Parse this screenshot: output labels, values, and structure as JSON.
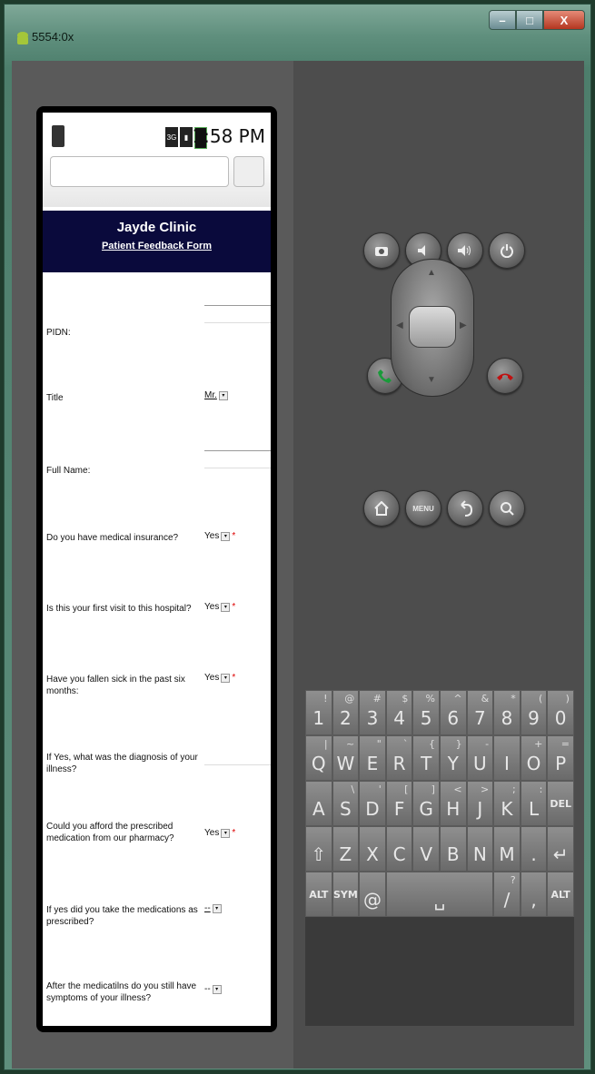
{
  "window": {
    "title": "5554:0x"
  },
  "phone": {
    "time": "1:58 PM",
    "network": "3G"
  },
  "page": {
    "clinic_name": "Jayde Clinic",
    "form_title": "Patient Feedback Form",
    "fields": [
      {
        "label": "PIDN:",
        "type": "text"
      },
      {
        "label": "Title",
        "type": "select",
        "value": "Mr."
      },
      {
        "label": "Full Name:",
        "type": "text"
      },
      {
        "label": "Do you have medical insurance?",
        "type": "select",
        "value": "Yes",
        "required": true
      },
      {
        "label": "Is this your first visit to this hospital?",
        "type": "select",
        "value": "Yes",
        "required": true
      },
      {
        "label": "Have you fallen sick in the past six months:",
        "type": "select",
        "value": "Yes",
        "required": true
      },
      {
        "label": "If Yes, what was the diagnosis of your illness?",
        "type": "text"
      },
      {
        "label": "Could you afford the prescribed medication from our pharmacy?",
        "type": "select",
        "value": "Yes",
        "required": true
      },
      {
        "label": "If yes did you take the medications as prescribed?",
        "type": "select",
        "value": "--"
      },
      {
        "label": "After the medicatilns do you still have symptoms of your illness?",
        "type": "select",
        "value": "--"
      }
    ],
    "required_mark": "*"
  },
  "hardware_buttons": {
    "menu_label": "MENU"
  },
  "keyboard": {
    "row1": [
      [
        "1",
        "!"
      ],
      [
        "2",
        "@"
      ],
      [
        "3",
        "#"
      ],
      [
        "4",
        "$"
      ],
      [
        "5",
        "%"
      ],
      [
        "6",
        "^"
      ],
      [
        "7",
        "&"
      ],
      [
        "8",
        "*"
      ],
      [
        "9",
        "("
      ],
      [
        "0",
        ")"
      ]
    ],
    "row2": [
      [
        "Q",
        "|"
      ],
      [
        "W",
        "~"
      ],
      [
        "E",
        "\""
      ],
      [
        "R",
        "`"
      ],
      [
        "T",
        "{"
      ],
      [
        "Y",
        "}"
      ],
      [
        "U",
        "-"
      ],
      [
        "I",
        ""
      ],
      [
        "O",
        "+"
      ],
      [
        "P",
        "="
      ]
    ],
    "row3": [
      [
        "A",
        ""
      ],
      [
        "S",
        "\\"
      ],
      [
        "D",
        "'"
      ],
      [
        "F",
        "["
      ],
      [
        "G",
        "]"
      ],
      [
        "H",
        "<"
      ],
      [
        "J",
        ">"
      ],
      [
        "K",
        ";"
      ],
      [
        "L",
        ":"
      ],
      [
        "DEL",
        ""
      ]
    ],
    "row4": [
      [
        "⇧",
        ""
      ],
      [
        "Z",
        ""
      ],
      [
        "X",
        ""
      ],
      [
        "C",
        ""
      ],
      [
        "V",
        ""
      ],
      [
        "B",
        ""
      ],
      [
        "N",
        ""
      ],
      [
        "M",
        ""
      ],
      [
        ".",
        ""
      ],
      [
        "↵",
        ""
      ]
    ],
    "row5": [
      [
        "ALT",
        ""
      ],
      [
        "SYM",
        ""
      ],
      [
        "@",
        ""
      ],
      [
        "␣",
        ""
      ],
      [
        "/",
        "?"
      ],
      [
        ",",
        ""
      ],
      [
        "ALT",
        ""
      ]
    ]
  }
}
